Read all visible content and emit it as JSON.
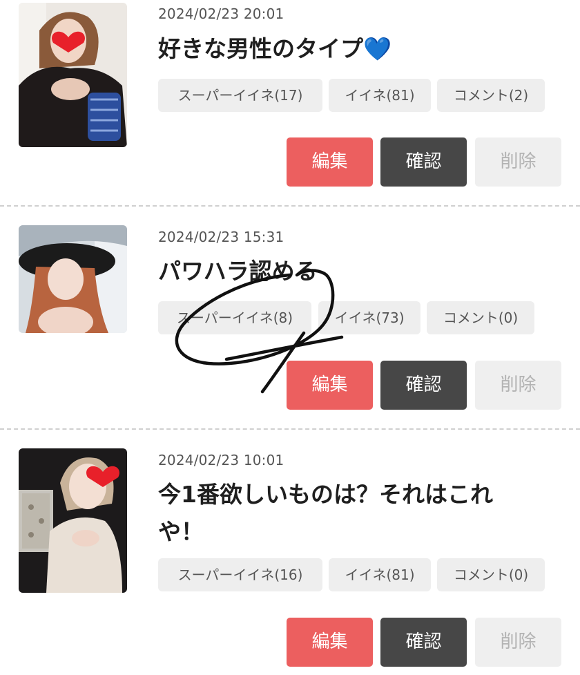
{
  "posts": [
    {
      "date": "2024/02/23 20:01",
      "title": "好きな男性のタイプ💙",
      "chips": [
        "スーパーイイネ(17)",
        "イイネ(81)",
        "コメント(2)"
      ],
      "buttons": {
        "edit": "編集",
        "confirm": "確認",
        "delete": "削除"
      }
    },
    {
      "date": "2024/02/23 15:31",
      "title": "パワハラ認める",
      "chips": [
        "スーパーイイネ(8)",
        "イイネ(73)",
        "コメント(0)"
      ],
      "buttons": {
        "edit": "編集",
        "confirm": "確認",
        "delete": "削除"
      }
    },
    {
      "date": "2024/02/23 10:01",
      "title": "今1番欲しいものは？それはこれや！",
      "chips": [
        "スーパーイイネ(16)",
        "イイネ(81)",
        "コメント(0)"
      ],
      "buttons": {
        "edit": "編集",
        "confirm": "確認",
        "delete": "削除"
      }
    }
  ],
  "colors": {
    "edit": "#ec5f5f",
    "confirm": "#474747",
    "delete_bg": "#efefef",
    "chip_bg": "#eeeeee"
  },
  "icons": {
    "heart_sticker": "red-heart-icon"
  }
}
